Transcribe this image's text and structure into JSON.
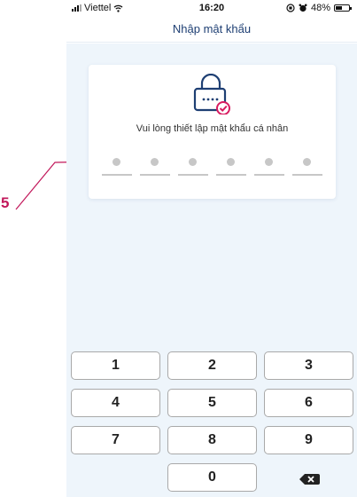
{
  "status_bar": {
    "carrier": "Viettel",
    "time": "16:20",
    "battery": "48%",
    "battery_level": 0.48
  },
  "header": {
    "title": "Nhập mật khẩu"
  },
  "card": {
    "prompt": "Vui lòng thiết lập mật khẩu cá nhân",
    "pin_length": 6
  },
  "keypad": {
    "keys": [
      "1",
      "2",
      "3",
      "4",
      "5",
      "6",
      "7",
      "8",
      "9",
      "0"
    ],
    "backspace_icon": "backspace-icon"
  },
  "annotation": {
    "number": "5",
    "color": "#c2185b"
  },
  "colors": {
    "title": "#1e3f73",
    "background": "#eef5fb",
    "accent": "#d81b60",
    "pin_placeholder": "#c7c7c7"
  }
}
